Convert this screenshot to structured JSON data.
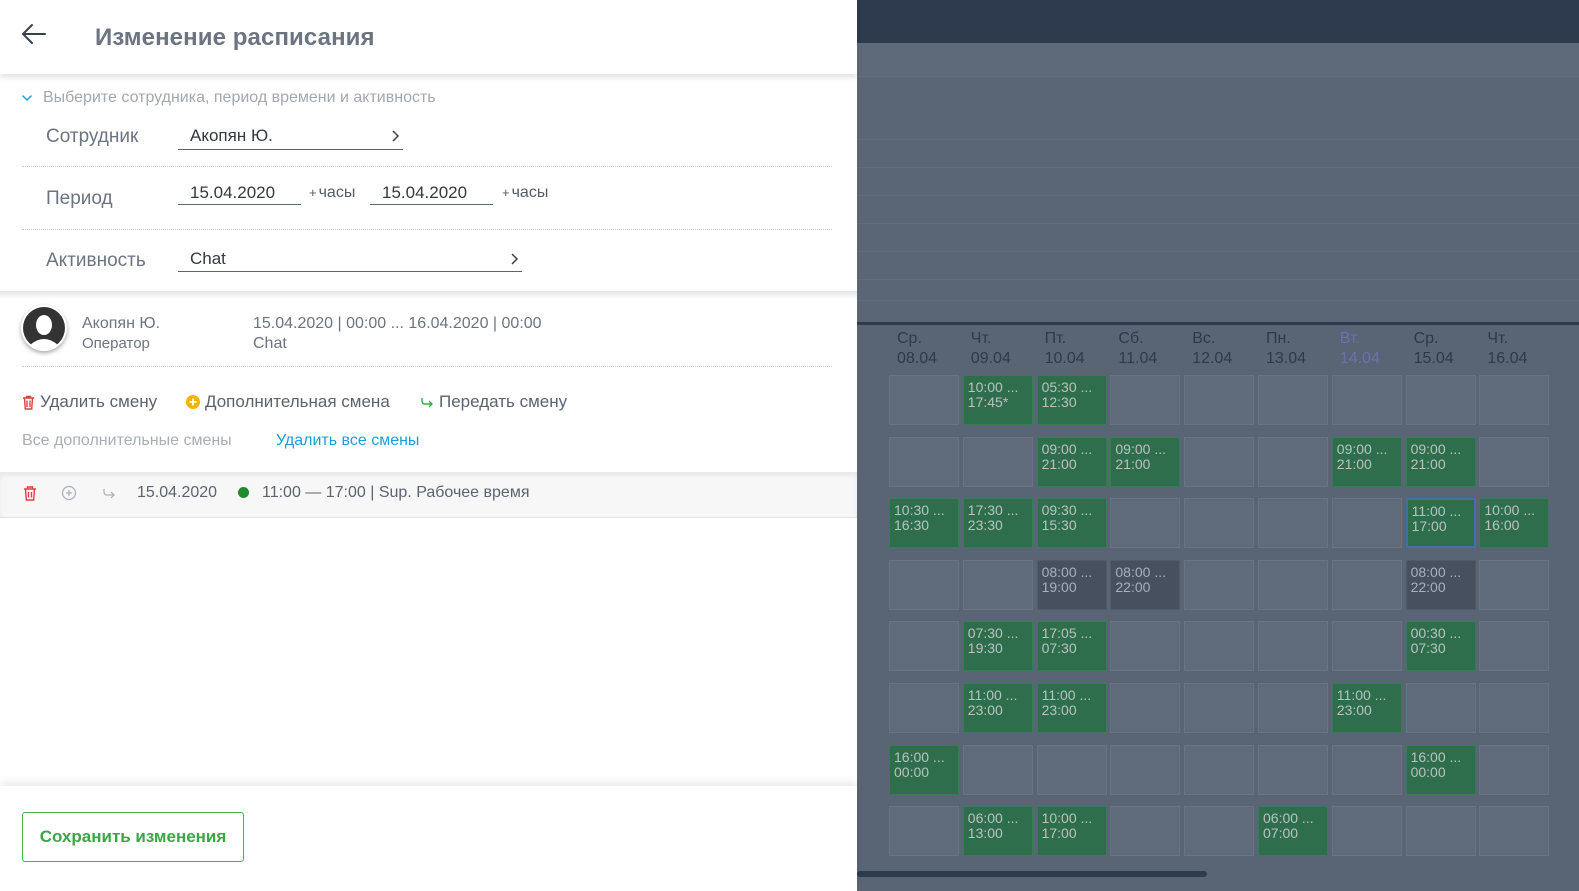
{
  "header": {
    "title": "Изменение расписания"
  },
  "form": {
    "section_label": "Выберите сотрудника, период времени и активность",
    "employee": {
      "label": "Сотрудник",
      "value": "Акопян Ю."
    },
    "period": {
      "label": "Период",
      "from": "15.04.2020",
      "to": "15.04.2020",
      "hours_label": "часы",
      "plus": "+"
    },
    "activity": {
      "label": "Активность",
      "value": "Chat"
    }
  },
  "employee_card": {
    "name": "Акопян Ю.",
    "role": "Оператор",
    "period": "15.04.2020 | 00:00 ... 16.04.2020 | 00:00",
    "activity": "Chat"
  },
  "actions": {
    "delete_shift": "Удалить смену",
    "additional_shift": "Дополнительная смена",
    "transfer_shift": "Передать смену",
    "all_additional": "Все дополнительные смены",
    "delete_all": "Удалить все смены"
  },
  "shift": {
    "date": "15.04.2020",
    "description": "11:00 — 17:00 | Sup. Рабочее время",
    "dot_color": "#1f8a2f"
  },
  "footer": {
    "save_label": "Сохранить изменения"
  },
  "background_schedule": {
    "days": [
      {
        "day": "Ср.",
        "date": "08.04"
      },
      {
        "day": "Чт.",
        "date": "09.04"
      },
      {
        "day": "Пт.",
        "date": "10.04"
      },
      {
        "day": "Сб.",
        "date": "11.04"
      },
      {
        "day": "Вс.",
        "date": "12.04"
      },
      {
        "day": "Пн.",
        "date": "13.04"
      },
      {
        "day": "Вт.",
        "date": "14.04",
        "today": true
      },
      {
        "day": "Ср.",
        "date": "15.04"
      },
      {
        "day": "Чт.",
        "date": "16.04"
      }
    ],
    "rows": [
      [
        null,
        "10:00 ...\n17:45*",
        "05:30 ...\n12:30",
        null,
        null,
        null,
        null,
        null,
        null
      ],
      [
        null,
        null,
        "09:00 ...\n21:00",
        "09:00 ...\n21:00",
        null,
        null,
        "09:00 ...\n21:00",
        "09:00 ...\n21:00",
        null
      ],
      [
        "10:30 ...\n16:30",
        "17:30 ...\n23:30",
        "09:30 ...\n15:30",
        null,
        null,
        null,
        null,
        "11:00 ...\n17:00",
        "10:00 ...\n16:00"
      ],
      [
        null,
        null,
        "08:00 ...\n19:00",
        "08:00 ...\n22:00",
        null,
        null,
        null,
        "08:00 ...\n22:00",
        null
      ],
      [
        null,
        "07:30 ...\n19:30",
        "17:05 ...\n07:30",
        null,
        null,
        null,
        null,
        "00:30 ...\n07:30",
        null
      ],
      [
        null,
        "11:00 ...\n23:00",
        "11:00 ...\n23:00",
        null,
        null,
        null,
        "11:00 ...\n23:00",
        null,
        null
      ],
      [
        "16:00 ...\n00:00",
        null,
        null,
        null,
        null,
        null,
        null,
        "16:00 ...\n00:00",
        null
      ],
      [
        null,
        "06:00 ...\n13:00",
        "10:00 ...\n17:00",
        null,
        null,
        "06:00 ...\n07:00",
        null,
        null,
        null
      ]
    ],
    "gray_cells": [
      "3-2",
      "3-3",
      "3-7"
    ],
    "selected_cell": "2-7"
  }
}
